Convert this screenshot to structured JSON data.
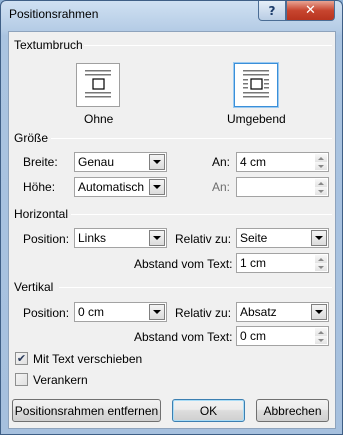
{
  "window": {
    "title": "Positionsrahmen",
    "help_glyph": "?",
    "close_glyph": "✕"
  },
  "textwrap": {
    "section_title": "Textumbruch",
    "none_label": "Ohne",
    "around_label": "Umgebend",
    "selected": "Umgebend"
  },
  "size": {
    "section_title": "Größe",
    "width_label": "Breite:",
    "width_value": "Genau",
    "width_at_label": "An:",
    "width_at_value": "4 cm",
    "height_label": "Höhe:",
    "height_value": "Automatisch",
    "height_at_label": "An:",
    "height_at_value": ""
  },
  "horizontal": {
    "section_title": "Horizontal",
    "position_label": "Position:",
    "position_value": "Links",
    "relative_label": "Relativ zu:",
    "relative_value": "Seite",
    "distance_label": "Abstand vom Text:",
    "distance_value": "1 cm"
  },
  "vertical": {
    "section_title": "Vertikal",
    "position_label": "Position:",
    "position_value": "0 cm",
    "relative_label": "Relativ zu:",
    "relative_value": "Absatz",
    "distance_label": "Abstand vom Text:",
    "distance_value": "0 cm",
    "move_with_text_label": "Mit Text verschieben",
    "move_with_text_checked": true,
    "lock_anchor_label": "Verankern",
    "lock_anchor_checked": false
  },
  "buttons": {
    "remove_label": "Positionsrahmen entfernen",
    "ok_label": "OK",
    "cancel_label": "Abbrechen"
  },
  "colors": {
    "selection_border": "#3a8fd9",
    "close_red": "#c7452f"
  }
}
